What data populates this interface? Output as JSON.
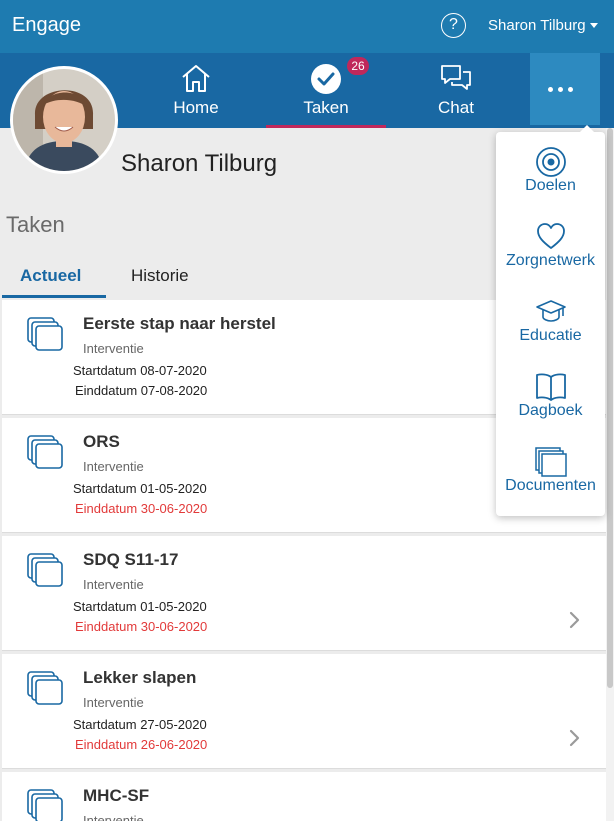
{
  "header": {
    "app_title": "Engage",
    "help_icon": "?",
    "user_menu": "Sharon Tilburg"
  },
  "nav": {
    "home": "Home",
    "taken": "Taken",
    "taken_badge": "26",
    "chat": "Chat",
    "more_icon": "ellipsis-icon"
  },
  "profile": {
    "name": "Sharon Tilburg",
    "avatar_icon": "profile-photo"
  },
  "section_title": "Taken",
  "tabs": {
    "actueel": "Actueel",
    "historie": "Historie"
  },
  "tasks": [
    {
      "title": "Eerste stap naar herstel",
      "type": "Interventie",
      "start": "Startdatum 08-07-2020",
      "end": "Einddatum 07-08-2020"
    },
    {
      "title": "ORS",
      "type": "Interventie",
      "start": "Startdatum 01-05-2020",
      "end": "Einddatum 30-06-2020"
    },
    {
      "title": "SDQ S11-17",
      "type": "Interventie",
      "start": "Startdatum 01-05-2020",
      "end": "Einddatum 30-06-2020"
    },
    {
      "title": "Lekker slapen",
      "type": "Interventie",
      "start": "Startdatum 27-05-2020",
      "end": "Einddatum 26-06-2020"
    },
    {
      "title": "MHC-SF",
      "type": "Interventie"
    }
  ],
  "dropdown": {
    "doelen": "Doelen",
    "zorgnetwerk": "Zorgnetwerk",
    "educatie": "Educatie",
    "dagboek": "Dagboek",
    "documenten": "Documenten"
  },
  "colors": {
    "header": "#1e7bb0",
    "nav": "#1968a3",
    "accent": "#c0285b",
    "overdue": "#e23a3a"
  }
}
